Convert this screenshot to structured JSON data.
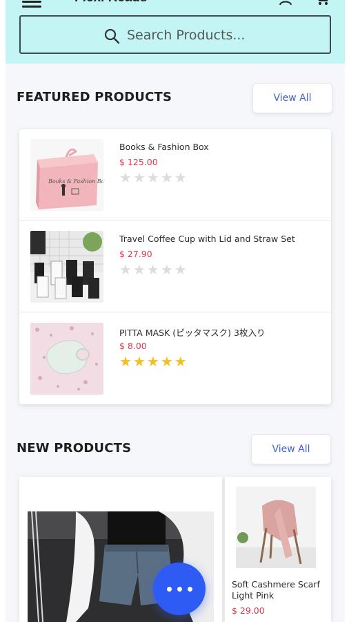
{
  "header": {
    "title": "Flexi Reads",
    "search_placeholder": "Search Products..."
  },
  "featured": {
    "title": "FEATURED PRODUCTS",
    "view_all": "View All",
    "items": [
      {
        "name": "Books & Fashion Box",
        "price": "$ 125.00",
        "rating": 0
      },
      {
        "name": "Travel Coffee Cup with Lid and Straw Set",
        "price": "$ 27.90",
        "rating": 0
      },
      {
        "name": "PITTA MASK (ピッタマスク) 3枚入り",
        "price": "$ 8.00",
        "rating": 5
      }
    ]
  },
  "new_products": {
    "title": "NEW PRODUCTS",
    "view_all": "View All",
    "items": [
      {
        "name": "",
        "price": ""
      },
      {
        "name": "Soft Cashmere Scarf Light Pink",
        "price": "$ 29.00"
      }
    ]
  },
  "icons": {
    "menu": "menu-icon",
    "user": "user-icon",
    "cart": "cart-icon",
    "search": "search-icon",
    "fab": "more-icon"
  },
  "colors": {
    "header_bg": "#c4f5f5",
    "price": "#e0374a",
    "star_on": "#f5bf1f",
    "star_off": "#dcdcdc",
    "link": "#3f63c9",
    "fab": "#2f5bf5"
  }
}
